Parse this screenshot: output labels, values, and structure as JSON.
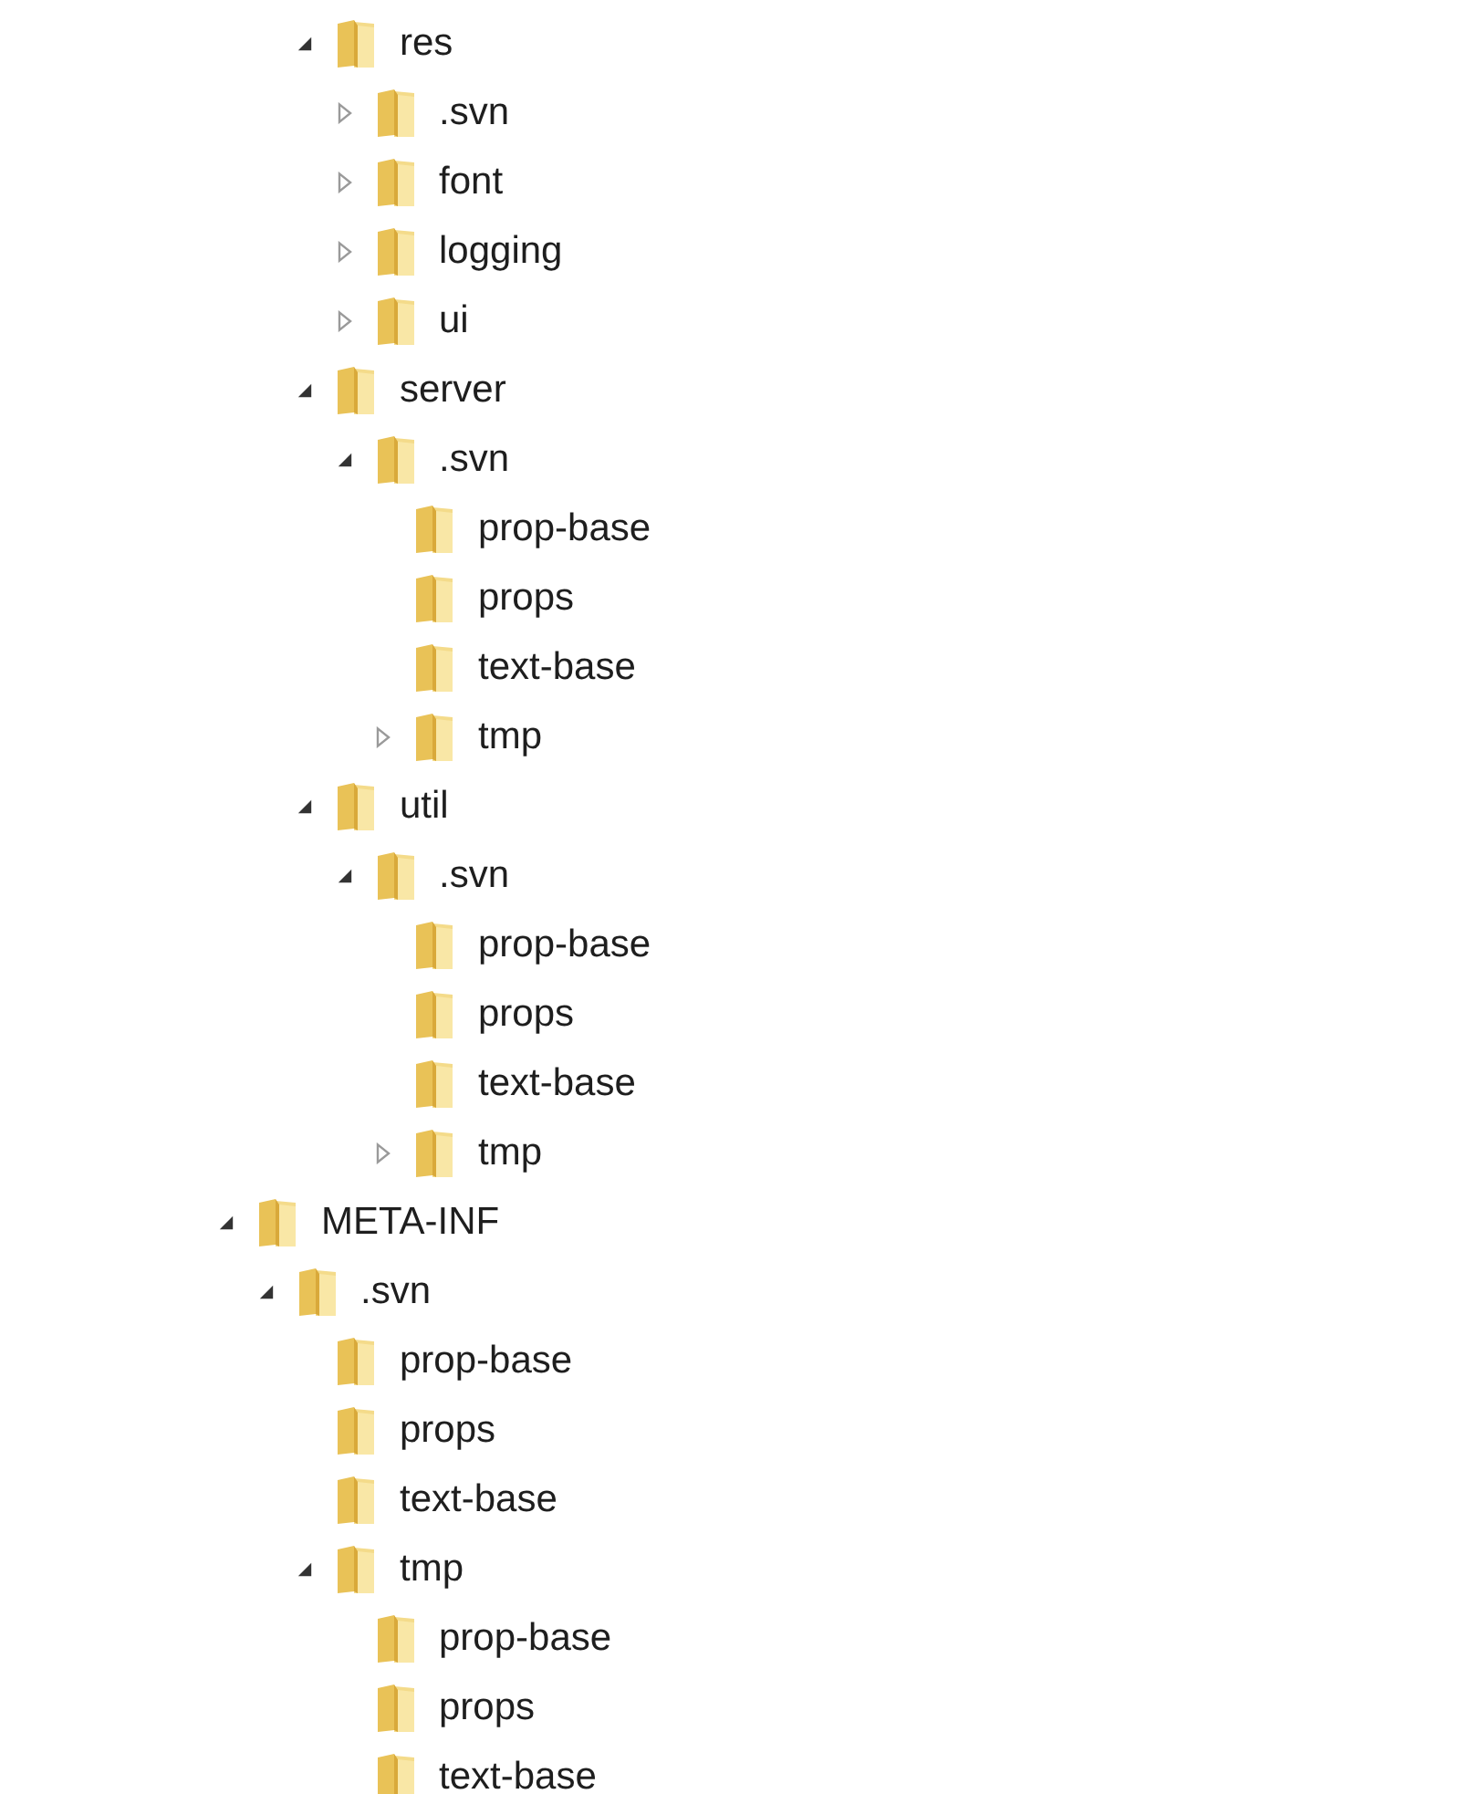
{
  "tree": {
    "items": [
      {
        "children": [
          {
            "children": [
              {
                "label": "res",
                "expanded": true,
                "children": [
                  {
                    "label": ".svn",
                    "expanded": false
                  },
                  {
                    "label": "font",
                    "expanded": false
                  },
                  {
                    "label": "logging",
                    "expanded": false
                  },
                  {
                    "label": "ui",
                    "expanded": false
                  }
                ]
              },
              {
                "label": "server",
                "expanded": true,
                "children": [
                  {
                    "label": ".svn",
                    "expanded": true,
                    "children": [
                      {
                        "label": "prop-base"
                      },
                      {
                        "label": "props"
                      },
                      {
                        "label": "text-base"
                      },
                      {
                        "label": "tmp",
                        "expanded": false
                      }
                    ]
                  }
                ]
              },
              {
                "label": "util",
                "expanded": true,
                "children": [
                  {
                    "label": ".svn",
                    "expanded": true,
                    "children": [
                      {
                        "label": "prop-base"
                      },
                      {
                        "label": "props"
                      },
                      {
                        "label": "text-base"
                      },
                      {
                        "label": "tmp",
                        "expanded": false
                      }
                    ]
                  }
                ]
              }
            ]
          }
        ]
      },
      {
        "label": "META-INF",
        "expanded": true,
        "children": [
          {
            "label": ".svn",
            "expanded": true,
            "children": [
              {
                "label": "prop-base"
              },
              {
                "label": "props"
              },
              {
                "label": "text-base"
              },
              {
                "label": "tmp",
                "expanded": true,
                "children": [
                  {
                    "label": "prop-base"
                  },
                  {
                    "label": "props"
                  },
                  {
                    "label": "text-base"
                  }
                ]
              }
            ]
          }
        ]
      }
    ]
  }
}
